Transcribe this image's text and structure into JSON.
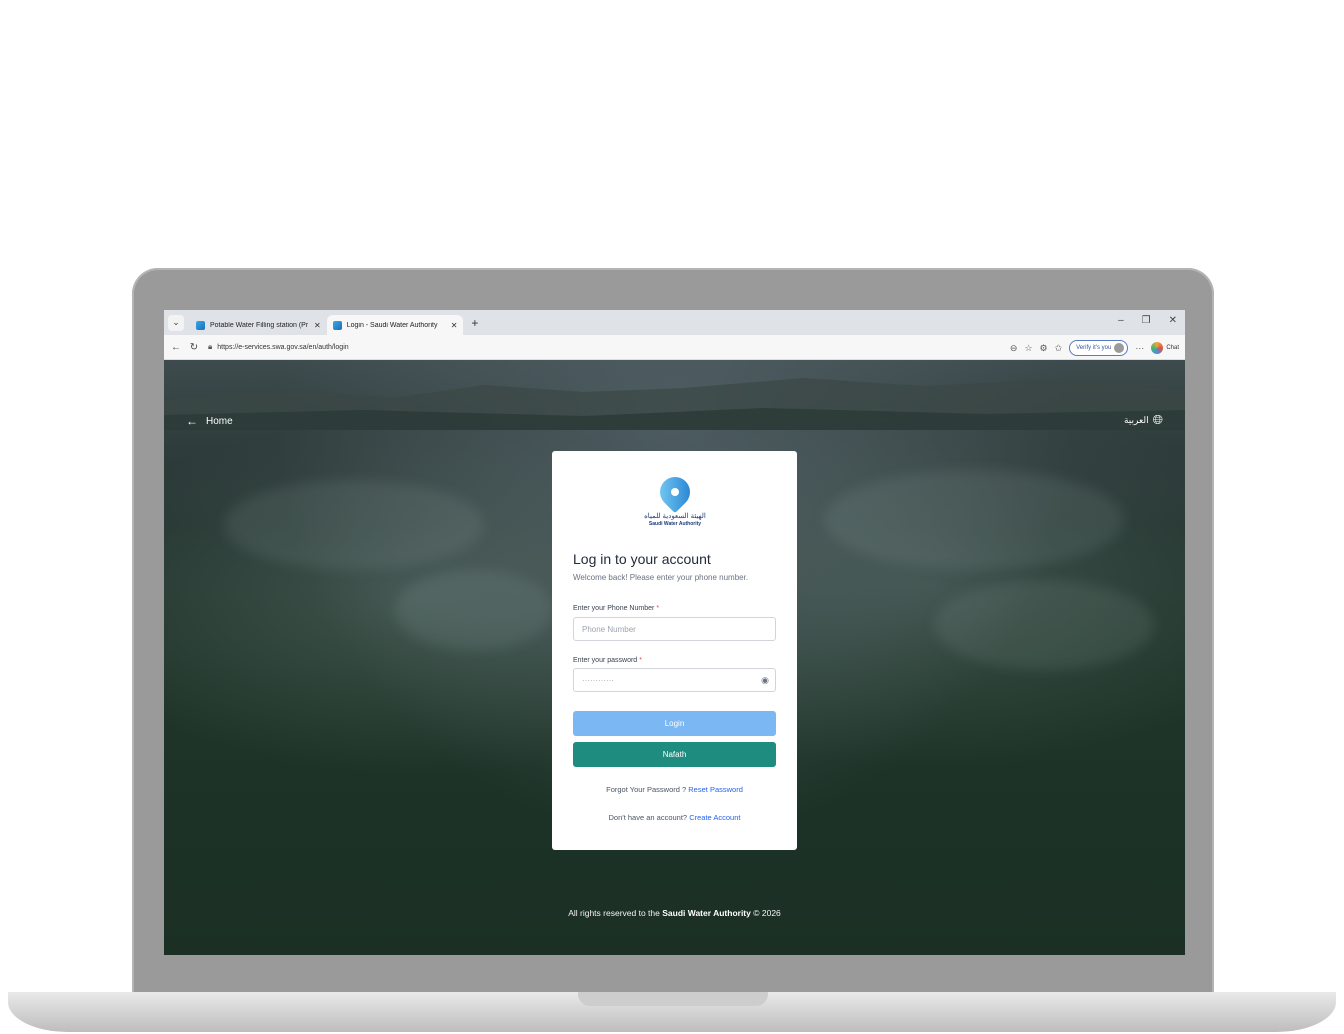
{
  "browser": {
    "tabs": [
      {
        "title": "Potable Water Filling station (Prod",
        "active": false
      },
      {
        "title": "Login - Saudi Water Authority",
        "active": true
      }
    ],
    "new_tab_label": "+",
    "url": "https://e-services.swa.gov.sa/en/auth/login",
    "verify_label": "Verify it's you",
    "more_label": "···",
    "chat_label": "Chat"
  },
  "header": {
    "home_label": "Home",
    "language_label": "العربية"
  },
  "logo": {
    "arabic_text": "الهيئة السعودية للمياه",
    "english_text": "Saudi Water Authority"
  },
  "login": {
    "title": "Log in to your account",
    "subtitle": "Welcome back! Please enter your phone number.",
    "phone_label": "Enter your Phone Number",
    "phone_placeholder": "Phone Number",
    "password_label": "Enter your password",
    "password_value": "············",
    "required_mark": "*",
    "login_button": "Login",
    "nafath_button": "Nafath",
    "forgot_text": "Forgot Your Password ?",
    "reset_link": "Reset Password",
    "no_account_text": "Don't have an account?",
    "create_link": "Create Account"
  },
  "footer": {
    "prefix": "All rights reserved to the",
    "org": "Saudi Water Authority",
    "suffix": "© 2026"
  }
}
